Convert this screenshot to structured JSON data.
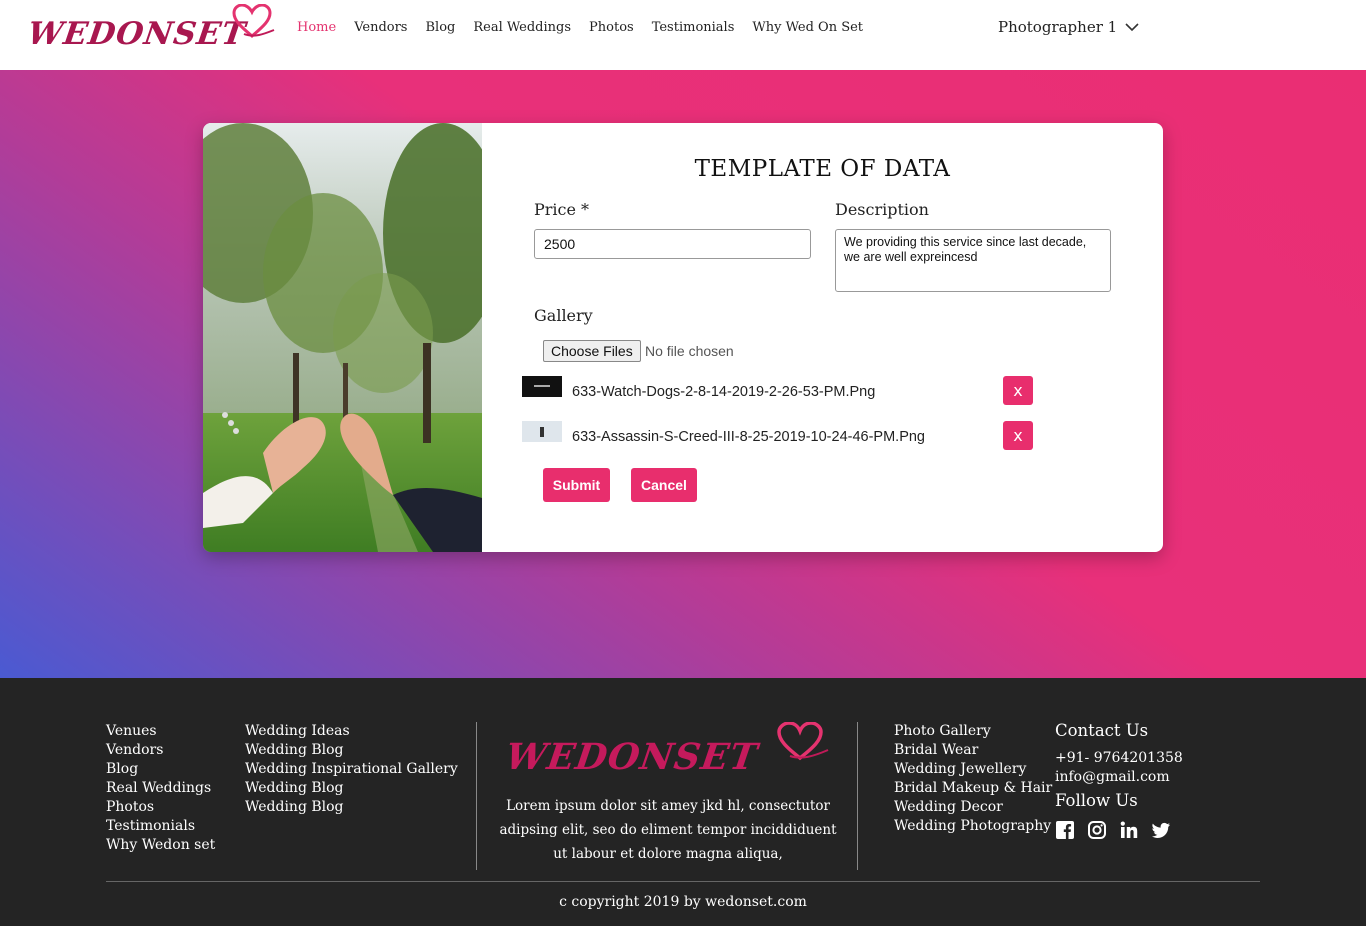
{
  "brand": {
    "logo_text": "WEDONSET",
    "brand_color": "#e82e6d"
  },
  "nav": {
    "items": [
      "Home",
      "Vendors",
      "Blog",
      "Real Weddings",
      "Photos",
      "Testimonials",
      "Why Wed On Set"
    ],
    "active": "Home",
    "user": "Photographer 1"
  },
  "form": {
    "title": "TEMPLATE OF DATA",
    "price_label": "Price *",
    "price_value": "2500",
    "description_label": "Description",
    "description_value": "We providing this service since last decade, we are well expreincesd",
    "gallery_label": "Gallery",
    "file_button": "Choose Files",
    "file_status": "No file chosen",
    "files": [
      {
        "name": "633-Watch-Dogs-2-8-14-2019-2-26-53-PM.Png",
        "remove": "x"
      },
      {
        "name": "633-Assassin-S-Creed-III-8-25-2019-10-24-46-PM.Png",
        "remove": "x"
      }
    ],
    "submit": "Submit",
    "cancel": "Cancel"
  },
  "footer": {
    "col1": [
      "Venues",
      "Vendors",
      "Blog",
      "Real Weddings",
      "Photos",
      "Testimonials",
      "Why Wedon set"
    ],
    "col2": [
      "Wedding Ideas",
      "Wedding Blog",
      "Wedding Inspirational Gallery",
      "Wedding Blog",
      "Wedding Blog"
    ],
    "logo_text": "WEDONSET",
    "description": "Lorem ipsum dolor sit amey jkd hl, consectutor adipsing elit, seo do eliment tempor inciddiduent ut labour et dolore magna aliqua,",
    "col3": [
      "Photo Gallery",
      "Bridal Wear",
      "Wedding Jewellery",
      "Bridal Makeup & Hair",
      "Wedding Decor",
      "Wedding Photography"
    ],
    "contact_title": "Contact Us",
    "phone": "+91- 9764201358",
    "email": "info@gmail.com",
    "follow_title": "Follow Us",
    "social": [
      "facebook-icon",
      "instagram-icon",
      "linkedin-icon",
      "twitter-icon"
    ],
    "copyright": "c copyright 2019 by wedonset.com"
  }
}
